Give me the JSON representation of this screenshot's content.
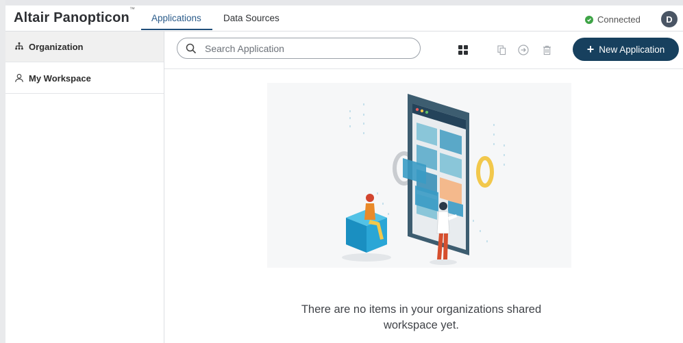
{
  "app": {
    "title": "Altair Panopticon",
    "trademark": "™"
  },
  "tabs": [
    {
      "label": "Applications",
      "active": true
    },
    {
      "label": "Data Sources",
      "active": false
    }
  ],
  "status": {
    "label": "Connected",
    "color": "#3fa447"
  },
  "user": {
    "initial": "D"
  },
  "sidebar": {
    "items": [
      {
        "label": "Organization",
        "icon": "org-chart-icon",
        "active": true
      },
      {
        "label": "My Workspace",
        "icon": "user-icon",
        "active": false
      }
    ]
  },
  "toolbar": {
    "search_placeholder": "Search Application",
    "search_value": "",
    "new_button_label": "New Application",
    "icons": [
      "grid-view-icon",
      "copy-icon",
      "move-icon",
      "delete-icon"
    ]
  },
  "main": {
    "empty_line1": "There are no items in your organizations shared",
    "empty_line2": "workspace yet."
  },
  "colors": {
    "accent": "#17405e",
    "active_tab": "#2a5b8a"
  }
}
